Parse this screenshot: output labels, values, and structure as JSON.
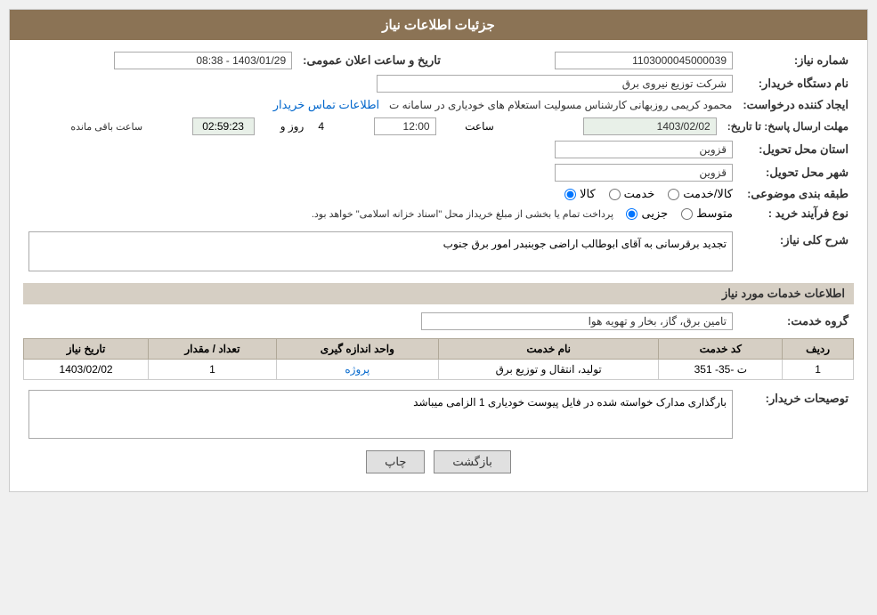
{
  "header": {
    "title": "جزئیات اطلاعات نیاز"
  },
  "form": {
    "need_number_label": "شماره نیاز:",
    "need_number_value": "1103000045000039",
    "buyer_org_label": "نام دستگاه خریدار:",
    "buyer_org_value": "شرکت توزیع نیروی برق",
    "creator_label": "ایجاد کننده درخواست:",
    "creator_value": "محمود کریمی روزبهانی کارشناس  مسولیت استعلام های خودیاری در سامانه ت",
    "creator_link": "اطلاعات تماس خریدار",
    "deadline_label": "مهلت ارسال پاسخ: تا تاریخ:",
    "deadline_date": "1403/02/02",
    "deadline_time_label": "ساعت",
    "deadline_time": "12:00",
    "deadline_days_label": "روز و",
    "deadline_days": "4",
    "countdown_label": "ساعت باقی مانده",
    "countdown_value": "02:59:23",
    "province_label": "استان محل تحویل:",
    "province_value": "قزوین",
    "city_label": "شهر محل تحویل:",
    "city_value": "قزوین",
    "category_label": "طبقه بندی موضوعی:",
    "category_goods": "کالا",
    "category_service": "خدمت",
    "category_goods_service": "کالا/خدمت",
    "purchase_type_label": "نوع فرآیند خرید :",
    "purchase_partial": "جزیی",
    "purchase_medium": "متوسط",
    "purchase_full_text": "پرداخت تمام یا بخشی از مبلغ خریداز محل \"اسناد خزانه اسلامی\" خواهد بود.",
    "description_label": "شرح کلی نیاز:",
    "description_value": "تجدید برقرسانی به آقای ابوطالب اراضی جوبنبدر امور برق جنوب",
    "services_section_title": "اطلاعات خدمات مورد نیاز",
    "service_group_label": "گروه خدمت:",
    "service_group_value": "تامین برق، گاز، بخار و تهویه هوا",
    "table_headers": {
      "row_num": "ردیف",
      "service_code": "کد خدمت",
      "service_name": "نام خدمت",
      "unit": "واحد اندازه گیری",
      "quantity": "تعداد / مقدار",
      "date": "تاریخ نیاز"
    },
    "table_rows": [
      {
        "row": "1",
        "code": "ت -35- 351",
        "name": "تولید، انتقال و توزیع برق",
        "unit": "پروژه",
        "quantity": "1",
        "date": "1403/02/02"
      }
    ],
    "buyer_notes_label": "توصیحات خریدار:",
    "buyer_notes_value": "بارگذاری مدارک خواسته شده در فایل پیوست خودیاری 1 الزامی میباشد",
    "publish_date_label": "تاریخ و ساعت اعلان عمومی:",
    "publish_date_value": "1403/01/29 - 08:38",
    "buttons": {
      "print": "چاپ",
      "back": "بازگشت"
    }
  }
}
